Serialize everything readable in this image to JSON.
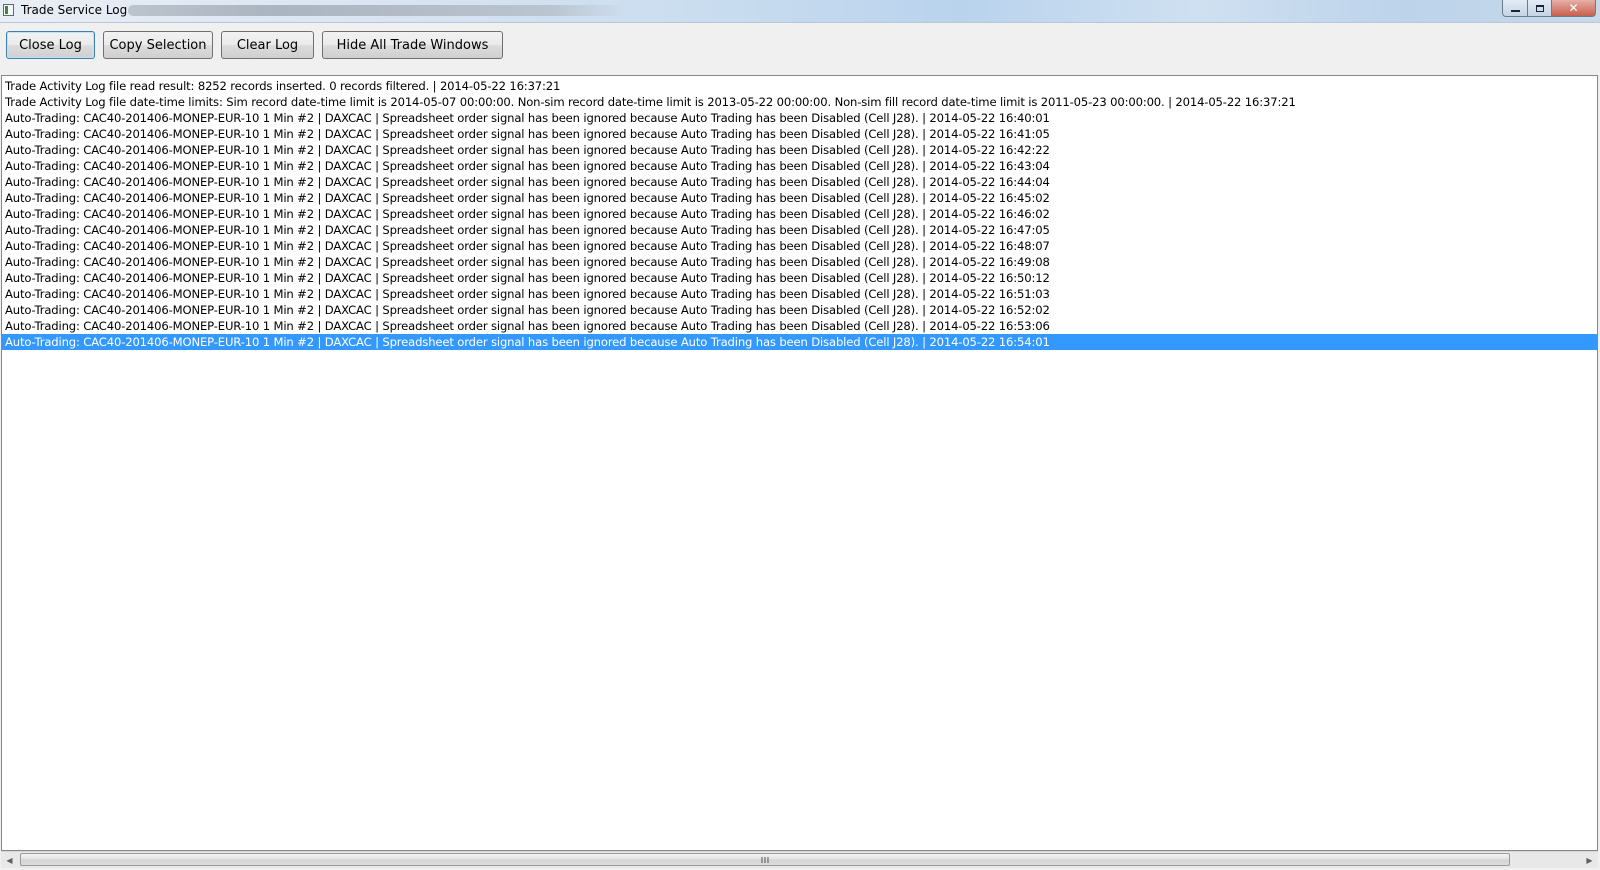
{
  "window": {
    "title": "Trade Service Log",
    "icons": {
      "app": "log-window-icon",
      "minimize": "minimize-icon",
      "maximize": "maximize-icon",
      "close": "close-icon"
    },
    "close_glyph": "✕"
  },
  "toolbar": {
    "close_log": "Close Log",
    "copy_selection": "Copy Selection",
    "clear_log": "Clear Log",
    "hide_all": "Hide All Trade Windows"
  },
  "log": {
    "selected_index": 16,
    "selection_color": "#3399ff",
    "rows": [
      "Trade Activity Log file read result: 8252 records inserted.  0 records filtered. | 2014-05-22  16:37:21",
      "Trade Activity Log file date-time limits: Sim record date-time limit is 2014-05-07  00:00:00.  Non-sim record date-time limit is 2013-05-22  00:00:00.  Non-sim fill record date-time limit is 2011-05-23  00:00:00. | 2014-05-22  16:37:21",
      "Auto-Trading: CAC40-201406-MONEP-EUR-10  1 Min   #2 | DAXCAC | Spreadsheet order signal has been ignored because Auto Trading has been Disabled (Cell J28). | 2014-05-22  16:40:01",
      "Auto-Trading: CAC40-201406-MONEP-EUR-10  1 Min   #2 | DAXCAC | Spreadsheet order signal has been ignored because Auto Trading has been Disabled (Cell J28). | 2014-05-22  16:41:05",
      "Auto-Trading: CAC40-201406-MONEP-EUR-10  1 Min   #2 | DAXCAC | Spreadsheet order signal has been ignored because Auto Trading has been Disabled (Cell J28). | 2014-05-22  16:42:22",
      "Auto-Trading: CAC40-201406-MONEP-EUR-10  1 Min   #2 | DAXCAC | Spreadsheet order signal has been ignored because Auto Trading has been Disabled (Cell J28). | 2014-05-22  16:43:04",
      "Auto-Trading: CAC40-201406-MONEP-EUR-10  1 Min   #2 | DAXCAC | Spreadsheet order signal has been ignored because Auto Trading has been Disabled (Cell J28). | 2014-05-22  16:44:04",
      "Auto-Trading: CAC40-201406-MONEP-EUR-10  1 Min   #2 | DAXCAC | Spreadsheet order signal has been ignored because Auto Trading has been Disabled (Cell J28). | 2014-05-22  16:45:02",
      "Auto-Trading: CAC40-201406-MONEP-EUR-10  1 Min   #2 | DAXCAC | Spreadsheet order signal has been ignored because Auto Trading has been Disabled (Cell J28). | 2014-05-22  16:46:02",
      "Auto-Trading: CAC40-201406-MONEP-EUR-10  1 Min   #2 | DAXCAC | Spreadsheet order signal has been ignored because Auto Trading has been Disabled (Cell J28). | 2014-05-22  16:47:05",
      "Auto-Trading: CAC40-201406-MONEP-EUR-10  1 Min   #2 | DAXCAC | Spreadsheet order signal has been ignored because Auto Trading has been Disabled (Cell J28). | 2014-05-22  16:48:07",
      "Auto-Trading: CAC40-201406-MONEP-EUR-10  1 Min   #2 | DAXCAC | Spreadsheet order signal has been ignored because Auto Trading has been Disabled (Cell J28). | 2014-05-22  16:49:08",
      "Auto-Trading: CAC40-201406-MONEP-EUR-10  1 Min   #2 | DAXCAC | Spreadsheet order signal has been ignored because Auto Trading has been Disabled (Cell J28). | 2014-05-22  16:50:12",
      "Auto-Trading: CAC40-201406-MONEP-EUR-10  1 Min   #2 | DAXCAC | Spreadsheet order signal has been ignored because Auto Trading has been Disabled (Cell J28). | 2014-05-22  16:51:03",
      "Auto-Trading: CAC40-201406-MONEP-EUR-10  1 Min   #2 | DAXCAC | Spreadsheet order signal has been ignored because Auto Trading has been Disabled (Cell J28). | 2014-05-22  16:52:02",
      "Auto-Trading: CAC40-201406-MONEP-EUR-10  1 Min   #2 | DAXCAC | Spreadsheet order signal has been ignored because Auto Trading has been Disabled (Cell J28). | 2014-05-22  16:53:06",
      "Auto-Trading: CAC40-201406-MONEP-EUR-10  1 Min   #2 | DAXCAC | Spreadsheet order signal has been ignored because Auto Trading has been Disabled (Cell J28). | 2014-05-22  16:54:01"
    ]
  },
  "scrollbar": {
    "left_arrow": "◀",
    "right_arrow": "▶",
    "icons": {
      "left": "scroll-left-arrow-icon",
      "right": "scroll-right-arrow-icon",
      "grip": "scroll-grip-icon"
    }
  }
}
